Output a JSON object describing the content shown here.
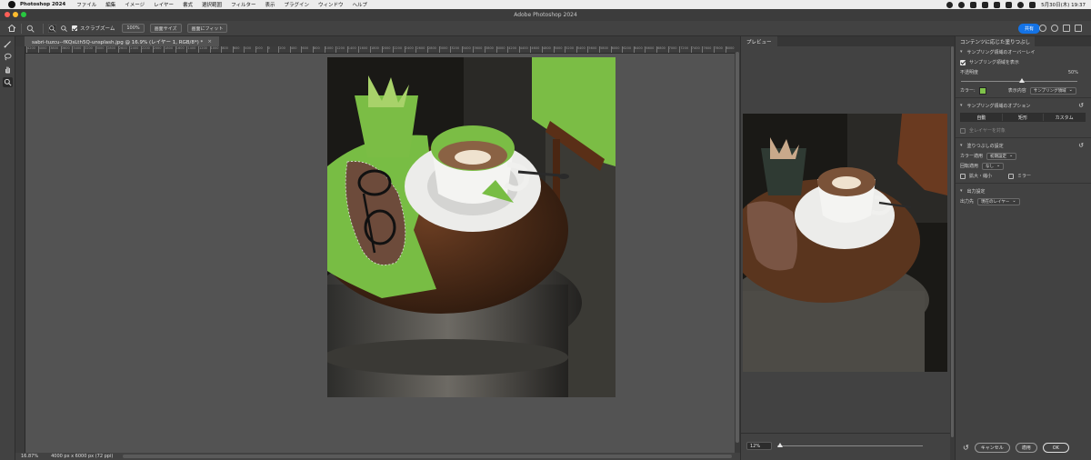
{
  "menubar": {
    "app_name": "Photoshop 2024",
    "items": [
      "ファイル",
      "編集",
      "イメージ",
      "レイヤー",
      "書式",
      "選択範囲",
      "フィルター",
      "表示",
      "プラグイン",
      "ウィンドウ",
      "ヘルプ"
    ],
    "clock": "5月30日(木)  19:37"
  },
  "window": {
    "title": "Adobe Photoshop 2024"
  },
  "options_bar": {
    "scrubby_zoom_label": "スクラブズーム",
    "zoom_100": "100%",
    "fit_screen": "画面サイズ",
    "fill_screen": "画面にフィット",
    "share": "共有"
  },
  "document": {
    "tab_title": "sabri-tuzcu--fKQsLth5Q-unsplash.jpg @ 16.9% (レイヤー 1, RGB/8*) *",
    "close_glyph": "×",
    "zoom": "16.87%",
    "doc_info": "4000 px x 6000 px (72 ppi)",
    "ruler_ticks": [
      "4200",
      "4000",
      "3800",
      "3600",
      "3400",
      "3200",
      "3000",
      "2800",
      "2600",
      "2400",
      "2200",
      "2000",
      "1800",
      "1600",
      "1400",
      "1200",
      "1000",
      "800",
      "600",
      "400",
      "200",
      "0",
      "200",
      "400",
      "600",
      "800",
      "1000",
      "1200",
      "1400",
      "1600",
      "1800",
      "2000",
      "2200",
      "2400",
      "2600",
      "2800",
      "3000",
      "3200",
      "3400",
      "3600",
      "3800",
      "4000",
      "4200",
      "4400",
      "4600",
      "4800",
      "5000",
      "5200",
      "5400",
      "5600",
      "5800",
      "6000",
      "6200",
      "6400",
      "6600",
      "6800",
      "7000",
      "7200",
      "7400",
      "7600",
      "7800",
      "8000"
    ]
  },
  "preview_panel": {
    "tab": "プレビュー",
    "zoom_value": "12%"
  },
  "fill_panel": {
    "title": "コンテンツに応じた塗りつぶし",
    "overlay_section": "サンプリング領域のオーバーレイ",
    "show_sampling": "サンプリング領域を表示",
    "opacity_label": "不透明度",
    "opacity_value": "50%",
    "color_label": "カラー:",
    "color_hex": "#7fc24a",
    "display_label": "表示内容",
    "display_value": "サンプリング領域",
    "options_section": "サンプリング領域のオプション",
    "sampling_modes": [
      "自動",
      "矩形",
      "カスタム"
    ],
    "all_layers": "全レイヤーを対象",
    "fill_settings_section": "塗りつぶしの設定",
    "color_adapt_label": "カラー適用",
    "color_adapt_value": "初期設定",
    "rotation_label": "回転適用",
    "rotation_value": "なし",
    "scale_label": "拡大・縮小",
    "mirror_label": "ミラー",
    "output_section": "出力設定",
    "output_label": "出力先",
    "output_value": "現在のレイヤー",
    "cancel": "キャンセル",
    "apply": "適用",
    "ok": "OK"
  }
}
